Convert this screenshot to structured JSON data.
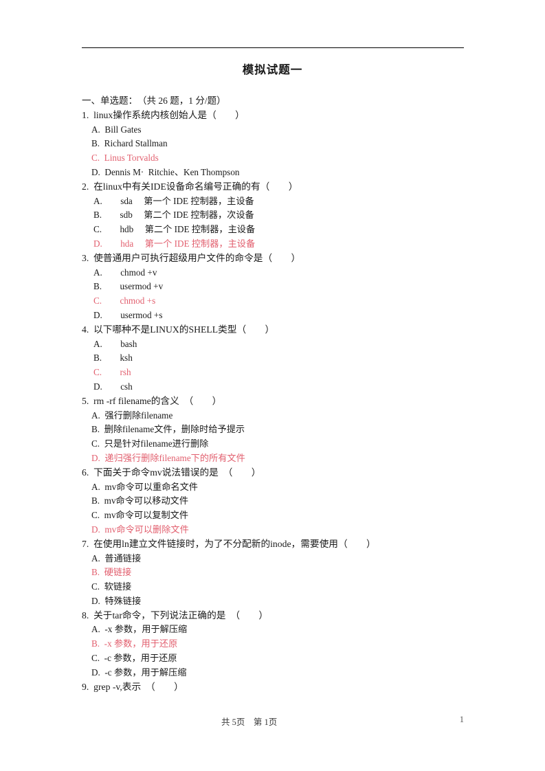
{
  "document": {
    "title": "模拟试题一",
    "section_heading": "一、单选题：　（共 26 题，1 分/题）",
    "answer_color": "#e2606f",
    "rule_color": "#000000"
  },
  "questions": [
    {
      "number": "1.",
      "stem": "1.  linux操作系统内核创始人是（        ）",
      "opt_style": "narrow",
      "options": [
        {
          "text": "A.  Bill Gates",
          "is_answer": false
        },
        {
          "text": "B.  Richard Stallman",
          "is_answer": false
        },
        {
          "text": "C.  Linus Torvalds",
          "is_answer": true
        },
        {
          "text": "D.  Dennis M·  Ritchie、Ken Thompson",
          "is_answer": false
        }
      ]
    },
    {
      "number": "2.",
      "stem": "2.  在linux中有关IDE设备命名编号正确的有（        ）",
      "opt_style": "wide",
      "options": [
        {
          "text": "A.　　sda　 第一个 IDE 控制器，主设备",
          "is_answer": false
        },
        {
          "text": "B.　　sdb　 第二个 IDE 控制器，次设备",
          "is_answer": false
        },
        {
          "text": "C.　　hdb　 第二个 IDE 控制器，主设备",
          "is_answer": false
        },
        {
          "text": "D.　　hda　 第一个 IDE 控制器，主设备",
          "is_answer": true
        }
      ]
    },
    {
      "number": "3.",
      "stem": "3.  使普通用户可执行超级用户文件的命令是（        ）",
      "opt_style": "wide",
      "options": [
        {
          "text": "A.　　chmod +v",
          "is_answer": false
        },
        {
          "text": "B.　　usermod +v",
          "is_answer": false
        },
        {
          "text": "C.　　chmod +s",
          "is_answer": true
        },
        {
          "text": "D.　　usermod +s",
          "is_answer": false
        }
      ]
    },
    {
      "number": "4.",
      "stem": "4.  以下哪种不是LINUX的SHELL类型（        ）",
      "opt_style": "wide",
      "options": [
        {
          "text": "A.　　bash",
          "is_answer": false
        },
        {
          "text": "B.　　ksh",
          "is_answer": false
        },
        {
          "text": "C.　　rsh",
          "is_answer": true
        },
        {
          "text": "D.　　csh",
          "is_answer": false
        }
      ]
    },
    {
      "number": "5.",
      "stem": "5.  rm -rf filename的含义  （        ）",
      "opt_style": "narrow",
      "options": [
        {
          "text": "A.  强行删除filename",
          "is_answer": false
        },
        {
          "text": "B.  删除filename文件，删除时给予提示",
          "is_answer": false
        },
        {
          "text": "C.  只是针对filename进行删除",
          "is_answer": false
        },
        {
          "text": "D.  递归强行删除filename下的所有文件",
          "is_answer": true
        }
      ]
    },
    {
      "number": "6.",
      "stem": "6.  下面关于命令mv说法错误的是  （        ）",
      "opt_style": "narrow",
      "options": [
        {
          "text": "A.  mv命令可以重命名文件",
          "is_answer": false
        },
        {
          "text": "B.  mv命令可以移动文件",
          "is_answer": false
        },
        {
          "text": "C.  mv命令可以复制文件",
          "is_answer": false
        },
        {
          "text": "D.  mv命令可以删除文件",
          "is_answer": true
        }
      ]
    },
    {
      "number": "7.",
      "stem": "7.  在使用ln建立文件链接时，为了不分配新的inode，需要使用（        ）",
      "opt_style": "narrow",
      "options": [
        {
          "text": "A.  普通链接",
          "is_answer": false
        },
        {
          "text": "B.  硬链接",
          "is_answer": true
        },
        {
          "text": "C.  软链接",
          "is_answer": false
        },
        {
          "text": "D.  特殊链接",
          "is_answer": false
        }
      ]
    },
    {
      "number": "8.",
      "stem": "8.  关于tar命令，下列说法正确的是  （        ）",
      "opt_style": "narrow",
      "options": [
        {
          "text": "A.  -x 参数，用于解压缩",
          "is_answer": false
        },
        {
          "text": "B.  -x 参数，用于还原",
          "is_answer": true
        },
        {
          "text": "C.  -c 参数，用于还原",
          "is_answer": false
        },
        {
          "text": "D.  -c 参数，用于解压缩",
          "is_answer": false
        }
      ]
    },
    {
      "number": "9.",
      "stem": "9.  grep -v,表示  （        ）",
      "opt_style": "narrow",
      "options": []
    }
  ],
  "footer": {
    "page_info": "共 5页　第 1页",
    "page_number": "1"
  }
}
